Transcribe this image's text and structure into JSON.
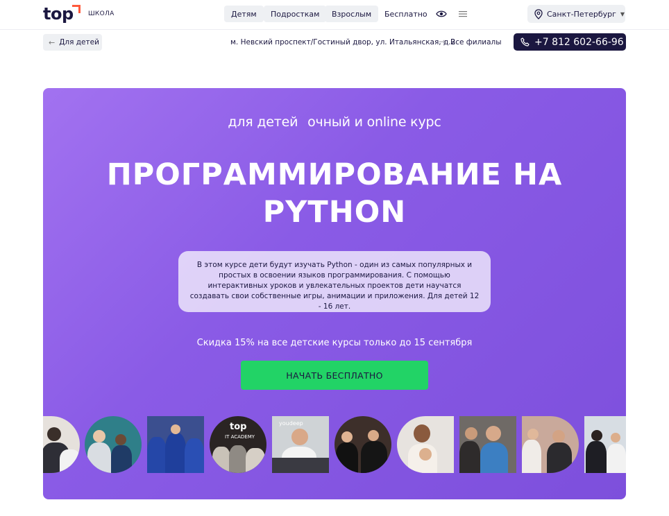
{
  "header": {
    "logo_word": "top",
    "logo_sub": "ШКОЛА",
    "nav": [
      "Детям",
      "Подросткам",
      "Взрослым",
      "Бесплатно"
    ],
    "city": "Санкт-Петербург"
  },
  "subbar": {
    "back_label": "Для детей",
    "address": "м. Невский проспект/Гостиный двор, ул. Итальянская, д.2",
    "branches_label": "Все филиалы",
    "phone": "+7 812 602-66-96"
  },
  "hero": {
    "tags": [
      "для детей",
      "очный и online курс"
    ],
    "title_line1": "ПРОГРАММИРОВАНИЕ НА",
    "title_line2": "PYTHON",
    "description": "В этом курсе дети будут изучать Python - один из самых популярных и простых в освоении языков программирования. С помощью интерактивных уроков и увлекательных проектов дети научатся создавать свои собственные игры, анимации и приложения. Для детей 12 - 16 лет.",
    "promo": "Скидка 15% на все детские курсы только до 15 сентября",
    "cta": "НАЧАТЬ БЕСПЛАТНО"
  },
  "photos": {
    "sign_top": "top",
    "sign_academy": "IT ACADEMY",
    "sign_youtube": "youdeep"
  },
  "colors": {
    "brand_dark": "#1b1740",
    "accent_orange": "#ff5a3c",
    "hero_purple": "#8a5be6",
    "cta_green": "#22d366"
  },
  "icons": [
    "eye-icon",
    "menu-icon",
    "location-pin-icon",
    "chevron-down-icon",
    "arrow-left-icon",
    "arrow-right-icon",
    "phone-icon"
  ]
}
